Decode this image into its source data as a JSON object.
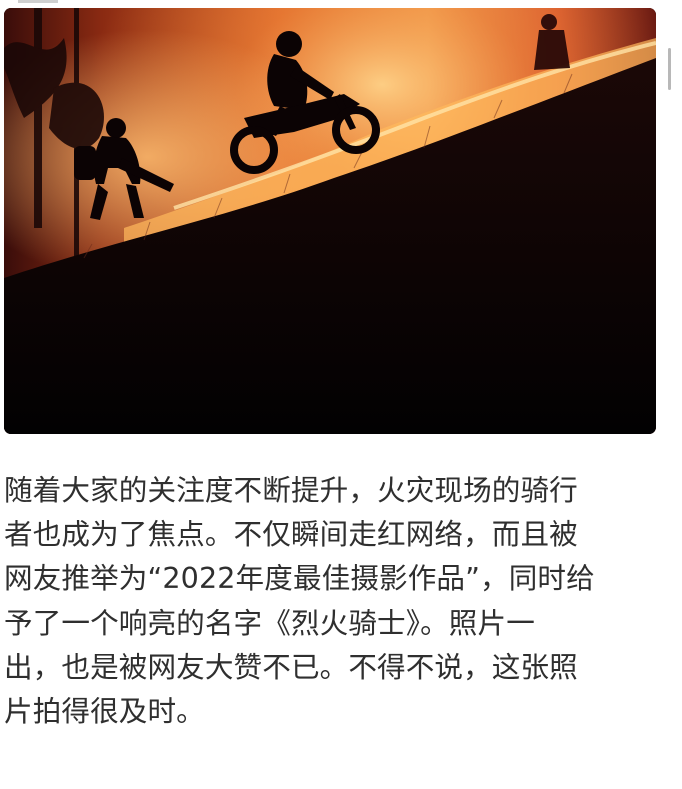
{
  "photo": {
    "icon": "photo-icon",
    "subject": "firefighter and motorcycle rider on hillside in wildfire"
  },
  "article": {
    "lines": [
      "随着大家的关注度不断提升，火灾现场的骑行",
      "者也成为了焦点。不仅瞬间走红网络，而且被",
      "网友推举为“2022年度最佳摄影作品”，同时给",
      "予了一个响亮的名字《烈火骑士》。照片一",
      "出，也是被网友大赞不已。不得不说，这张照",
      "片拍得很及时。"
    ]
  },
  "colors": {
    "text": "#2f2f2f",
    "background": "#ffffff",
    "fire": "#f08a3a",
    "night": "#050203"
  }
}
